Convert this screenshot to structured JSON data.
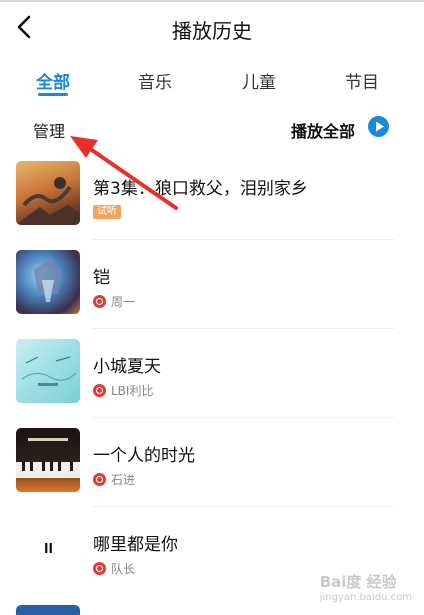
{
  "header": {
    "title": "播放历史",
    "back_icon": "chevron-left-icon"
  },
  "tabs": [
    {
      "label": "全部",
      "active": true
    },
    {
      "label": "音乐",
      "active": false
    },
    {
      "label": "儿童",
      "active": false
    },
    {
      "label": "节目",
      "active": false
    }
  ],
  "toolbar": {
    "manage_label": "管理",
    "play_all_label": "播放全部",
    "play_all_icon": "play-circle-icon"
  },
  "colors": {
    "accent": "#1a8ad6",
    "badge": "#f3a35c",
    "source": "#e03c37"
  },
  "items": [
    {
      "title": "第3集：狼口救父，泪别家乡",
      "badge": "试听",
      "artist": ""
    },
    {
      "title": "铠",
      "badge": "",
      "artist": "周一"
    },
    {
      "title": "小城夏天",
      "badge": "",
      "artist": "LBI利比"
    },
    {
      "title": "一个人的时光",
      "badge": "",
      "artist": "石进"
    },
    {
      "title": "哪里都是你",
      "badge": "",
      "artist": "队长",
      "paused_glyph": "ll"
    }
  ],
  "watermark": {
    "brand": "Bai度 经验",
    "url": "jingyan.baidu.com"
  }
}
